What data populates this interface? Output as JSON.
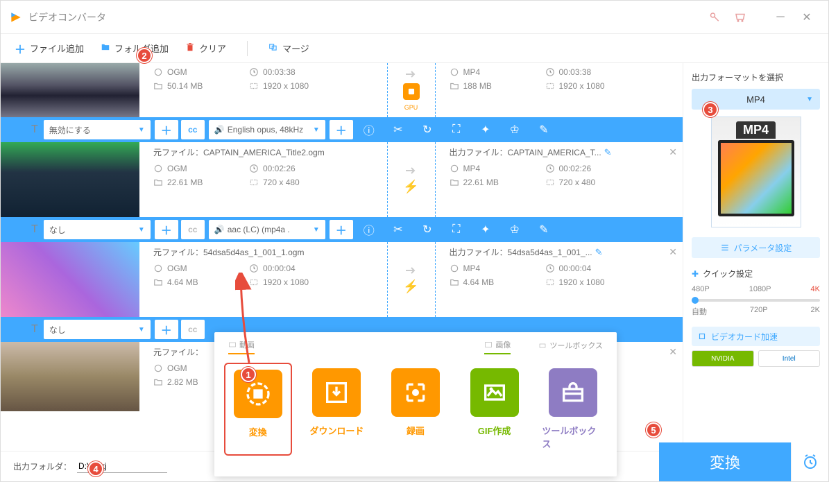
{
  "window": {
    "title": "ビデオコンバータ"
  },
  "toolbar": {
    "add_file": "ファイル追加",
    "add_folder": "フォルダ追加",
    "clear": "クリア",
    "merge": "マージ"
  },
  "files": [
    {
      "src_format": "OGM",
      "src_duration": "00:03:38",
      "src_size": "50.14 MB",
      "src_res": "1920 x 1080",
      "dst_format": "MP4",
      "dst_duration": "00:03:38",
      "dst_size": "188 MB",
      "dst_res": "1920 x 1080",
      "accel": "GPU",
      "subtitle": "無効にする",
      "audio": "English opus, 48kHz"
    },
    {
      "src_label": "元ファイル：",
      "src_name": "CAPTAIN_AMERICA_Title2.ogm",
      "dst_label": "出力ファイル：",
      "dst_name": "CAPTAIN_AMERICA_T...",
      "src_format": "OGM",
      "src_duration": "00:02:26",
      "src_size": "22.61 MB",
      "src_res": "720 x 480",
      "dst_format": "MP4",
      "dst_duration": "00:02:26",
      "dst_size": "22.61 MB",
      "dst_res": "720 x 480",
      "subtitle": "なし",
      "audio": "aac (LC) (mp4a ."
    },
    {
      "src_label": "元ファイル：",
      "src_name": "54dsa5d4as_1_001_1.ogm",
      "dst_label": "出力ファイル：",
      "dst_name": "54dsa5d4as_1_001_...",
      "src_format": "OGM",
      "src_duration": "00:00:04",
      "src_size": "4.64 MB",
      "src_res": "1920 x 1080",
      "dst_format": "MP4",
      "dst_duration": "00:00:04",
      "dst_size": "4.64 MB",
      "dst_res": "1920 x 1080",
      "subtitle": "なし"
    },
    {
      "src_label": "元ファイル：",
      "src_format": "OGM",
      "src_size": "2.82 MB"
    }
  ],
  "output": {
    "label": "出力フォルダ：",
    "path": "D:¥ff¥kj"
  },
  "right": {
    "heading": "出力フォーマットを選択",
    "format": "MP4",
    "preview_label": "MP4",
    "param_btn": "パラメータ設定",
    "quick_heading": "クイック設定",
    "res": {
      "p480": "480P",
      "p1080": "1080P",
      "p4k": "4K",
      "auto": "自動",
      "p720": "720P",
      "p2k": "2K"
    },
    "gpu_accel": "ビデオカード加速",
    "nvidia": "NVIDIA",
    "intel": "Intel"
  },
  "convert": "変換",
  "popup": {
    "tab_video": "動画",
    "tab_image": "画像",
    "tab_tools": "ツールボックス",
    "tiles": {
      "convert": "変換",
      "download": "ダウンロード",
      "record": "録画",
      "gif": "GIF作成",
      "toolbox": "ツールボックス"
    }
  },
  "badges": {
    "b1": "1",
    "b2": "2",
    "b3": "3",
    "b4": "4",
    "b5": "5"
  }
}
